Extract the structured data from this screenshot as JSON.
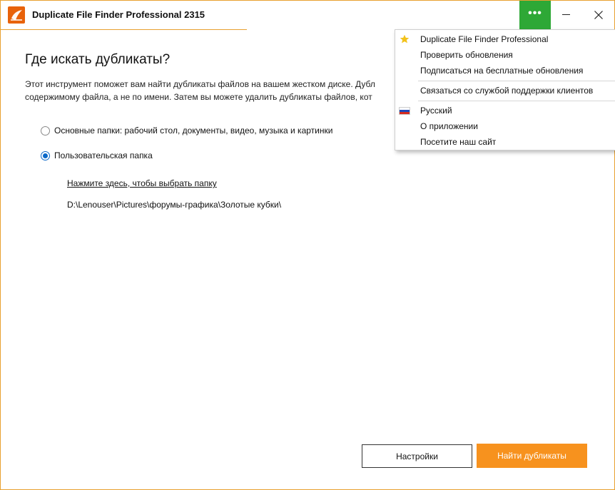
{
  "window": {
    "title": "Duplicate File Finder Professional 2315",
    "more_label": "•••",
    "minimize_label": "",
    "close_label": ""
  },
  "main": {
    "heading": "Где искать дубликаты?",
    "description_line1": "Этот инструмент поможет вам найти дубликаты файлов на вашем жестком диске. Дубл",
    "description_line2": "содержимому файла, а не по имени. Затем вы можете удалить дубликаты файлов, кот",
    "options": [
      {
        "label": "Основные папки: рабочий стол, документы, видео, музыка и картинки",
        "selected": false
      },
      {
        "label": "Пользовательская папка",
        "selected": true
      }
    ],
    "choose_folder_link": "Нажмите здесь, чтобы выбрать папку",
    "folder_path": "D:\\Lenouser\\Pictures\\форумы-графика\\Золотые кубки\\"
  },
  "buttons": {
    "settings": "Настройки",
    "find": "Найти дубликаты"
  },
  "menu": {
    "items": [
      {
        "label": "Duplicate File Finder Professional",
        "icon": "star-icon"
      },
      {
        "label": "Проверить обновления",
        "icon": ""
      },
      {
        "label": "Подписаться на бесплатные обновления",
        "icon": ""
      },
      {
        "label": "Связаться со службой поддержки клиентов",
        "icon": ""
      },
      {
        "label": "Русский",
        "icon": "russian-flag-icon"
      },
      {
        "label": "О приложении",
        "icon": ""
      },
      {
        "label": "Посетите наш сайт",
        "icon": ""
      }
    ]
  },
  "colors": {
    "accent_orange": "#f7921e",
    "more_button_green": "#2ea836",
    "radio_blue": "#0b68c8",
    "window_border": "#e8a030"
  }
}
